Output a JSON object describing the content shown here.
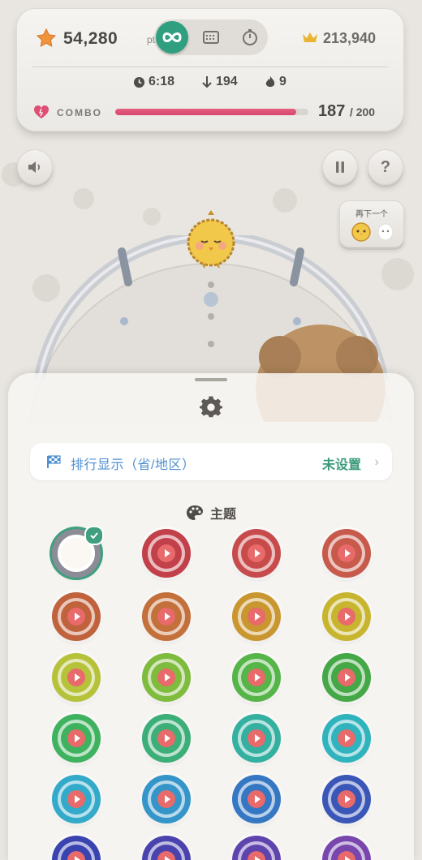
{
  "score": {
    "value": "54,280",
    "unit": "pt",
    "best": "213,940"
  },
  "modes": [
    {
      "name": "endless",
      "icon": "infinity-icon",
      "active": true
    },
    {
      "name": "calendar",
      "icon": "calendar-icon",
      "active": false
    },
    {
      "name": "timer",
      "icon": "stopwatch-icon",
      "active": false
    }
  ],
  "stats": {
    "time": "6:18",
    "drops": "194",
    "streak": "9"
  },
  "combo": {
    "label": "COMBO",
    "count": "187",
    "max": "/ 200",
    "fraction": 0.935
  },
  "next": {
    "label": "再下一个"
  },
  "settings": {
    "rank_label": "排行显示（省/地区）",
    "rank_value": "未设置",
    "theme_title": "主题",
    "selected_index": 0
  },
  "colors": {
    "accent": "#2f9f7f",
    "combo": "#dd4f74",
    "link": "#4d8fd0",
    "theme_rings": [
      "#8b8c96",
      "#c2404a",
      "#c84b4b",
      "#c75a4a",
      "#c0623c",
      "#c3703b",
      "#c9962f",
      "#c8b52f",
      "#b6c23a",
      "#7fbb3c",
      "#56b548",
      "#43a845",
      "#3fb25f",
      "#3cae78",
      "#34b0a0",
      "#2fb3bc",
      "#33aac9",
      "#3595c8",
      "#3577c3",
      "#3a57b8",
      "#3a44b0",
      "#4a43ae",
      "#6044ae",
      "#7846ac"
    ]
  }
}
